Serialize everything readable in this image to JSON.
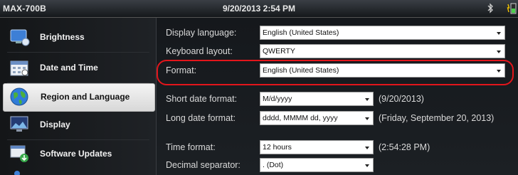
{
  "titlebar": {
    "device": "MAX-700B",
    "datetime": "9/20/2013 2:54 PM",
    "icons": [
      "bluetooth-icon",
      "battery-icon"
    ]
  },
  "sidebar": {
    "items": [
      {
        "label": "Brightness",
        "icon": "brightness-icon",
        "selected": false
      },
      {
        "label": "Date and Time",
        "icon": "calendar-icon",
        "selected": false
      },
      {
        "label": "Region and Language",
        "icon": "globe-icon",
        "selected": true
      },
      {
        "label": "Display",
        "icon": "display-icon",
        "selected": false
      },
      {
        "label": "Software Updates",
        "icon": "software-update-icon",
        "selected": false
      }
    ]
  },
  "settings": {
    "display_language": {
      "label": "Display language:",
      "value": "English (United States)"
    },
    "keyboard_layout": {
      "label": "Keyboard layout:",
      "value": "QWERTY"
    },
    "format": {
      "label": "Format:",
      "value": "English (United States)"
    },
    "short_date": {
      "label": "Short date format:",
      "value": "M/d/yyyy",
      "sample": "(9/20/2013)"
    },
    "long_date": {
      "label": "Long date format:",
      "value": "dddd, MMMM dd, yyyy",
      "sample": "(Friday, September 20, 2013)"
    },
    "time_format": {
      "label": "Time format:",
      "value": "12 hours",
      "sample": "(2:54:28 PM)"
    },
    "decimal_separator": {
      "label": "Decimal separator:",
      "value": ". (Dot)"
    }
  },
  "colors": {
    "highlight": "#e3151b",
    "selected_bg": "#e8e8e8"
  }
}
